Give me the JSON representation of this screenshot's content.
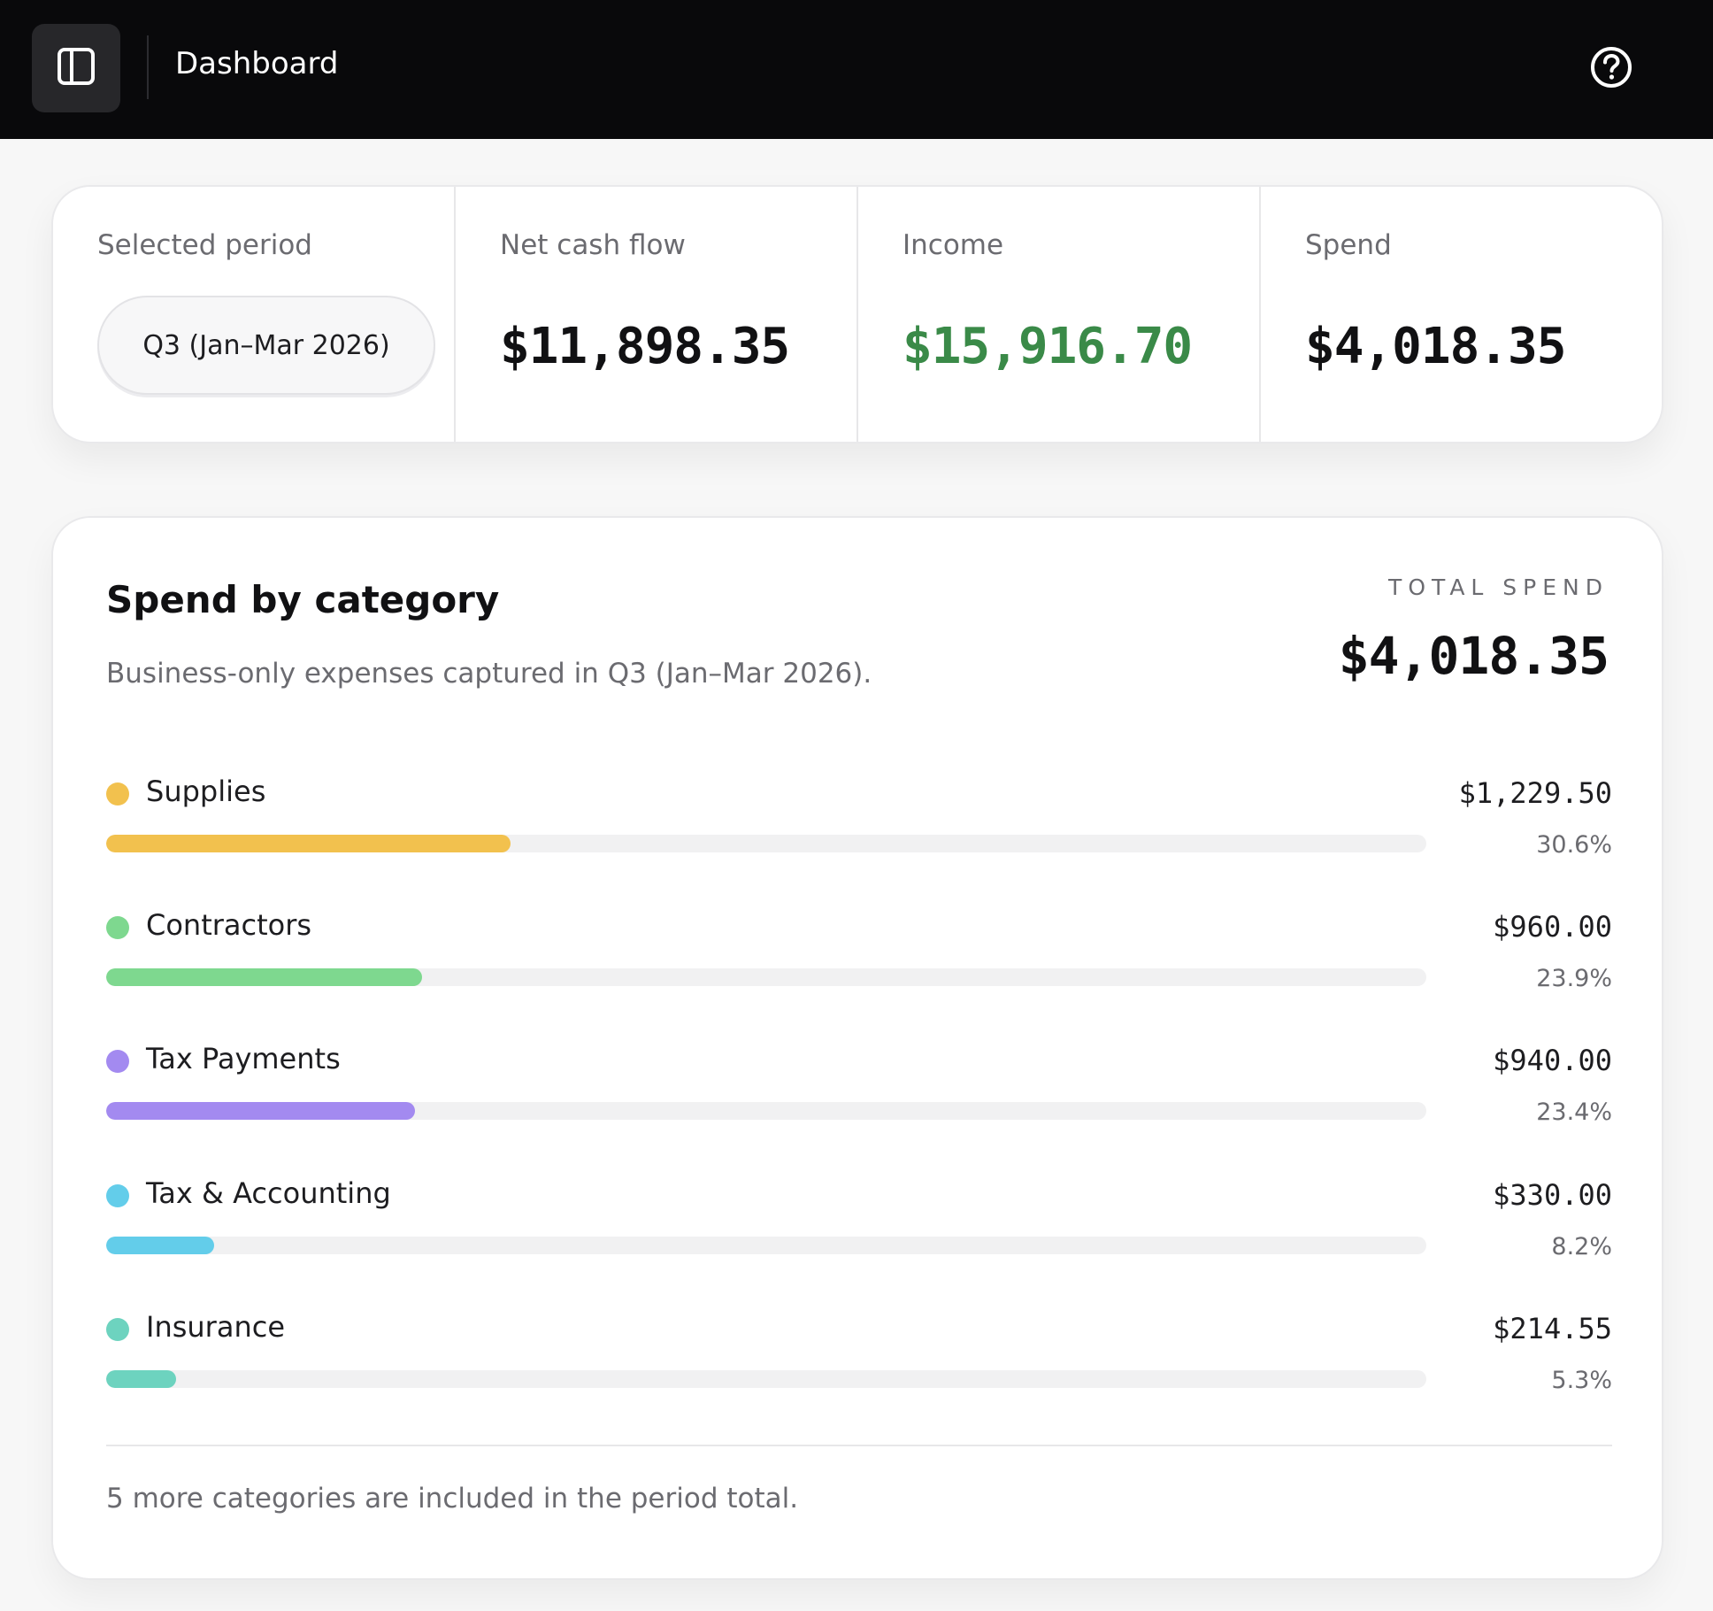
{
  "topbar": {
    "title": "Dashboard",
    "sidebar_toggle_icon": "sidebar-panel-icon",
    "help_icon": "help-circle-icon"
  },
  "stats": {
    "period": {
      "label": "Selected period",
      "value": "Q3 (Jan–Mar 2026)"
    },
    "net_cash_flow": {
      "label": "Net cash flow",
      "value": "$11,898.35"
    },
    "income": {
      "label": "Income",
      "value": "$15,916.70",
      "color": "#3a8a48"
    },
    "spend": {
      "label": "Spend",
      "value": "$4,018.35"
    }
  },
  "spend_by_category": {
    "title": "Spend by category",
    "subtitle": "Business-only expenses captured in Q3 (Jan–Mar 2026).",
    "total_label": "TOTAL SPEND",
    "total_value": "$4,018.35",
    "categories": [
      {
        "name": "Supplies",
        "amount": "$1,229.50",
        "percent": "30.6%",
        "share": 0.306,
        "color": "#f2c14e"
      },
      {
        "name": "Contractors",
        "amount": "$960.00",
        "percent": "23.9%",
        "share": 0.239,
        "color": "#7ed88f"
      },
      {
        "name": "Tax Payments",
        "amount": "$940.00",
        "percent": "23.4%",
        "share": 0.234,
        "color": "#a38af0"
      },
      {
        "name": "Tax & Accounting",
        "amount": "$330.00",
        "percent": "8.2%",
        "share": 0.082,
        "color": "#63cdea"
      },
      {
        "name": "Insurance",
        "amount": "$214.55",
        "percent": "5.3%",
        "share": 0.053,
        "color": "#6dd3bf"
      }
    ],
    "footer_note": "5 more categories are included in the period total."
  }
}
